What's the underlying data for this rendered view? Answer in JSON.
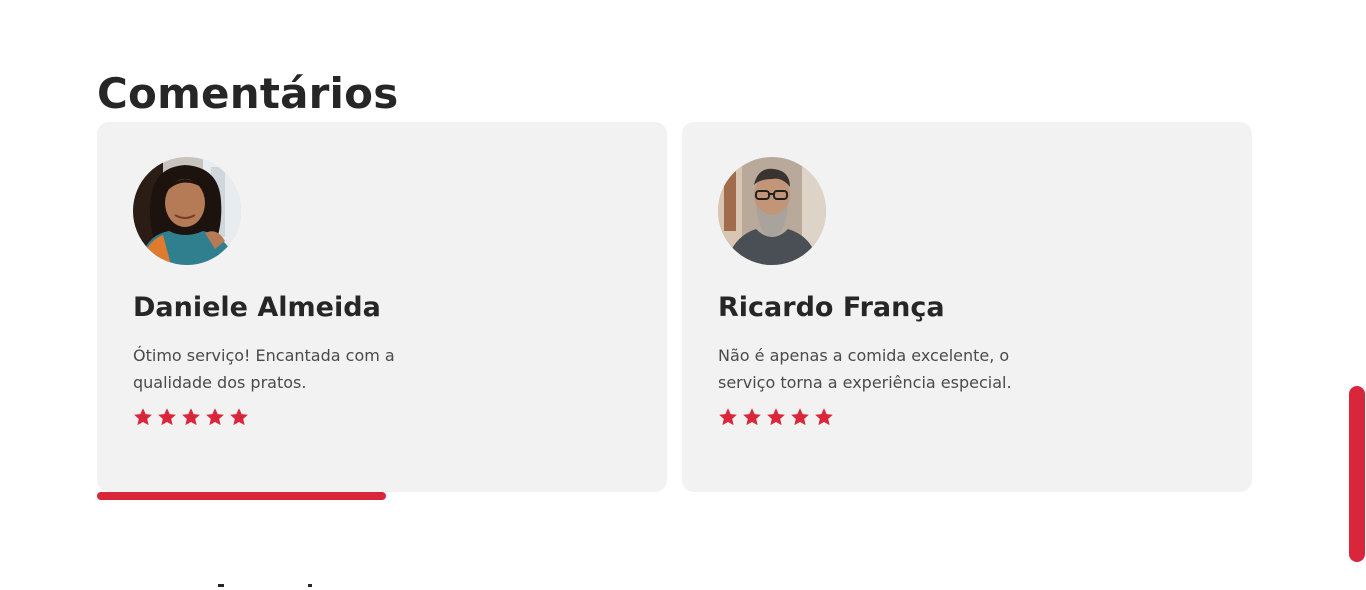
{
  "section": {
    "title": "Comentários"
  },
  "colors": {
    "accent": "#d9263a",
    "card_bg": "#f2f2f2",
    "text_dark": "#262626",
    "text_body": "#4a4a4a"
  },
  "testimonials": [
    {
      "name": "Daniele Almeida",
      "text": "Ótimo serviço! Encantada com a qualidade dos pratos.",
      "rating": 5,
      "avatar_icon": "avatar-photo-woman"
    },
    {
      "name": "Ricardo França",
      "text": "Não é apenas a comida excelente, o serviço torna a experiência especial.",
      "rating": 5,
      "avatar_icon": "avatar-photo-man"
    }
  ],
  "carousel": {
    "progress": 0.25
  }
}
